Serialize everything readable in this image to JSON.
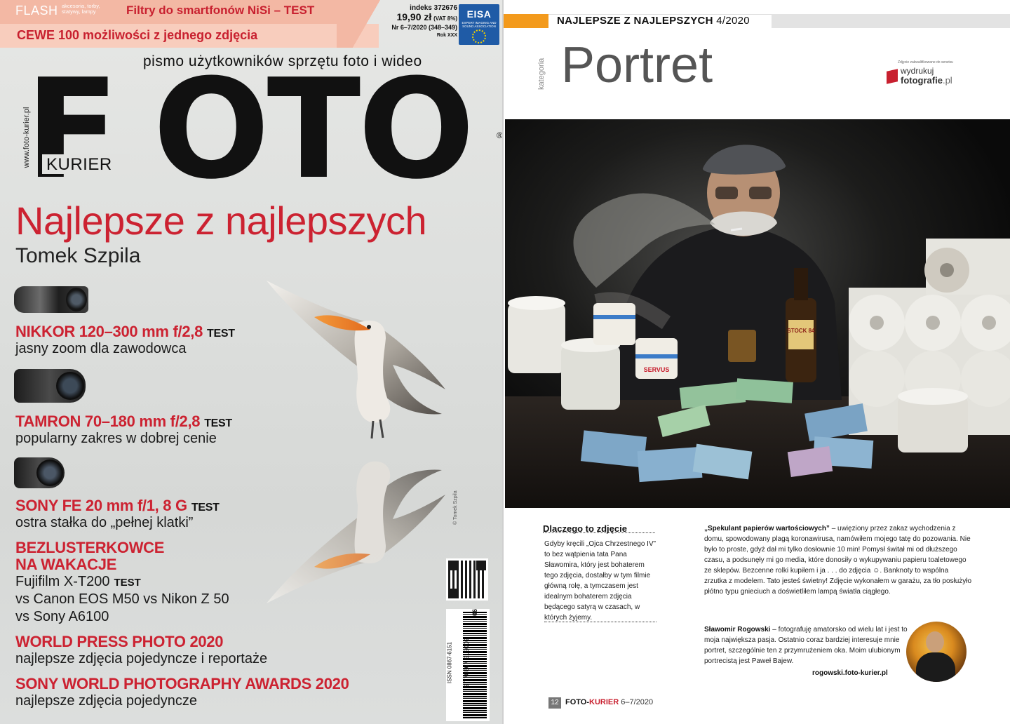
{
  "cover": {
    "flash": "FLASH",
    "flash_small": "akcesoria, torby, statywy, lampy",
    "filtry": "Filtry do smartfonów NiSi – TEST",
    "cewe_brand": "CEWE",
    "cewe_text": "100 możliwości z jednego zdjęcia",
    "index": "indeks 372676",
    "price": "19,90 zł",
    "vat": "(VAT 8%)",
    "issue": "Nr 6–7/2020 (348–349)",
    "year": "Rok XXX",
    "eisa": "EISA",
    "eisa_sub": "EXPERT IMAGING AND SOUND ASSOCIATION",
    "tagline": "pismo użytkowników sprzętu foto i wideo",
    "foto_f": "F",
    "foto_rest": "OTO",
    "reg": "®",
    "kurier": "KURIER",
    "url_vertical": "www.foto-kurier.pl",
    "headline": "Najlepsze z najlepszych",
    "author": "Tomek Szpila",
    "items": [
      {
        "title": "NIKKOR 120–300 mm f/2,8",
        "test": "TEST",
        "desc": "jasny zoom dla zawodowca"
      },
      {
        "title": "TAMRON 70–180 mm f/2,8",
        "test": "TEST",
        "desc": "popularny zakres w dobrej cenie"
      },
      {
        "title": "SONY FE 20 mm f/1, 8 G",
        "test": "TEST",
        "desc": "ostra stałka do „pełnej klatki”"
      },
      {
        "title_line1": "BEZLUSTERKOWCE",
        "title_line2": "NA WAKACJE",
        "desc_line1": "Fujifilm X-T200",
        "test": "TEST",
        "desc_line2": "vs Canon EOS M50 vs Nikon Z 50",
        "desc_line3": "vs Sony A6100"
      },
      {
        "title": "WORLD PRESS PHOTO 2020",
        "desc": "najlepsze zdjęcia pojedyncze i reportaże"
      },
      {
        "title": "SONY WORLD PHOTOGRAPHY AWARDS 2020",
        "desc": "najlepsze zdjęcia pojedyncze"
      }
    ],
    "credit": "© Tomek Szpila",
    "issn": "ISSN 0867-6151",
    "barcode_num": "9 770867 615006",
    "barcode_issue": "06",
    "accent_color": "#cc2231"
  },
  "article": {
    "header_bold": "NAJLEPSZE Z NAJLEPSZYCH",
    "header_issue": "4/2020",
    "kategoria": "kategoria",
    "title": "Portret",
    "logo_small": "Zdjęcie zakwalifikowane do serwisu",
    "logo_line1": "wydrukuj",
    "logo_line2_bold": "fotografie",
    "logo_line2_suffix": ".pl",
    "caption_title": "Dlaczego to zdjęcie",
    "caption_text": "Gdyby kręcili „Ojca Chrzestnego IV” to bez wątpienia tata Pana Sławomira, który jest bohaterem tego zdjęcia, dostałby w tym filmie główną rolę, a tymczasem jest idealnym bohaterem zdjęcia będącego satyrą w czasach, w których żyjemy.",
    "main_title": "„Spekulant papierów wartościowych”",
    "main_text": " – uwięziony przez zakaz wychodzenia z domu, spowodowany plagą koronawirusa, namówiłem mojego tatę do pozowania. Nie było to proste, gdyż dał mi tylko dosłownie 10 min! Pomysł świtał mi od dłuższego czasu, a podsunęły mi go media, które donosiły o wykupywaniu papieru toaletowego ze sklepów. Bezcenne rolki kupiłem i ja . . . do zdjęcia ☺. Banknoty to wspólna zrzutka z modelem. Tato jesteś świetny! Zdjęcie wykonałem w garażu, za tło posłużyło płótno typu gnieciuch a doświetliłem lampą światła ciągłego.",
    "bio_name": "Sławomir Rogowski",
    "bio_text": " – fotografuję amatorsko od wielu lat i jest to moja największa pasja. Ostatnio coraz bardziej interesuje mnie portret, szczególnie ten z przymrużeniem oka. Moim ulubionym portrecistą jest Paweł Bajew.",
    "bio_url": "rogowski.foto-kurier.pl",
    "footer_page": "12",
    "footer_brand_a": "FOTO-",
    "footer_brand_b": "KURIER",
    "footer_issue": "6–7/2020",
    "photo_labels": {
      "bottle": "STOCK 84",
      "roll": "SERVUS"
    },
    "accent_color": "#f39a1c"
  }
}
